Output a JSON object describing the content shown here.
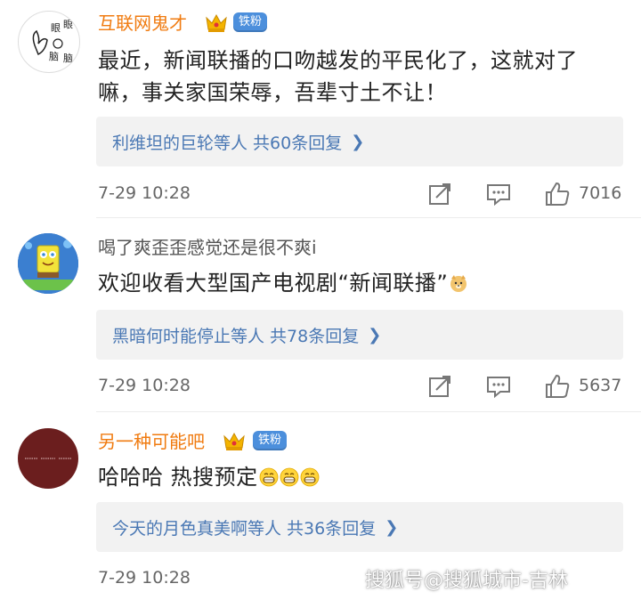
{
  "comments": [
    {
      "username": "互联网鬼才",
      "badge": "铁粉",
      "avatar_text": [
        "眼",
        "眼",
        "脑",
        "脑"
      ],
      "content": "最近，新闻联播的口吻越发的平民化了，这就对了嘛，事关家国荣辱，吾辈寸土不让！",
      "reply_text": "利维坦的巨轮等人 共60条回复",
      "time": "7-29 10:28",
      "likes": "7016"
    },
    {
      "username": "喝了爽歪歪感觉还是很不爽i",
      "content": "欢迎收看大型国产电视剧“新闻联播”",
      "reply_text": "黑暗何时能停止等人 共78条回复",
      "time": "7-29 10:28",
      "likes": "5637"
    },
    {
      "username": "另一种可能吧",
      "badge": "铁粉",
      "content": "哈哈哈  热搜预定",
      "reply_text": "今天的月色真美啊等人 共36条回复",
      "time": "7-29 10:28"
    }
  ],
  "watermark": "搜狐号@搜狐城市-吉林",
  "colors": {
    "username_accent": "#f07b10",
    "reply_link": "#4a78b4",
    "badge_bg": "#4c8fdc",
    "avatar3_bg": "#6b1e1e"
  },
  "icons": [
    "share-icon",
    "comment-icon",
    "like-icon",
    "crown-icon",
    "chevron-right-icon"
  ]
}
